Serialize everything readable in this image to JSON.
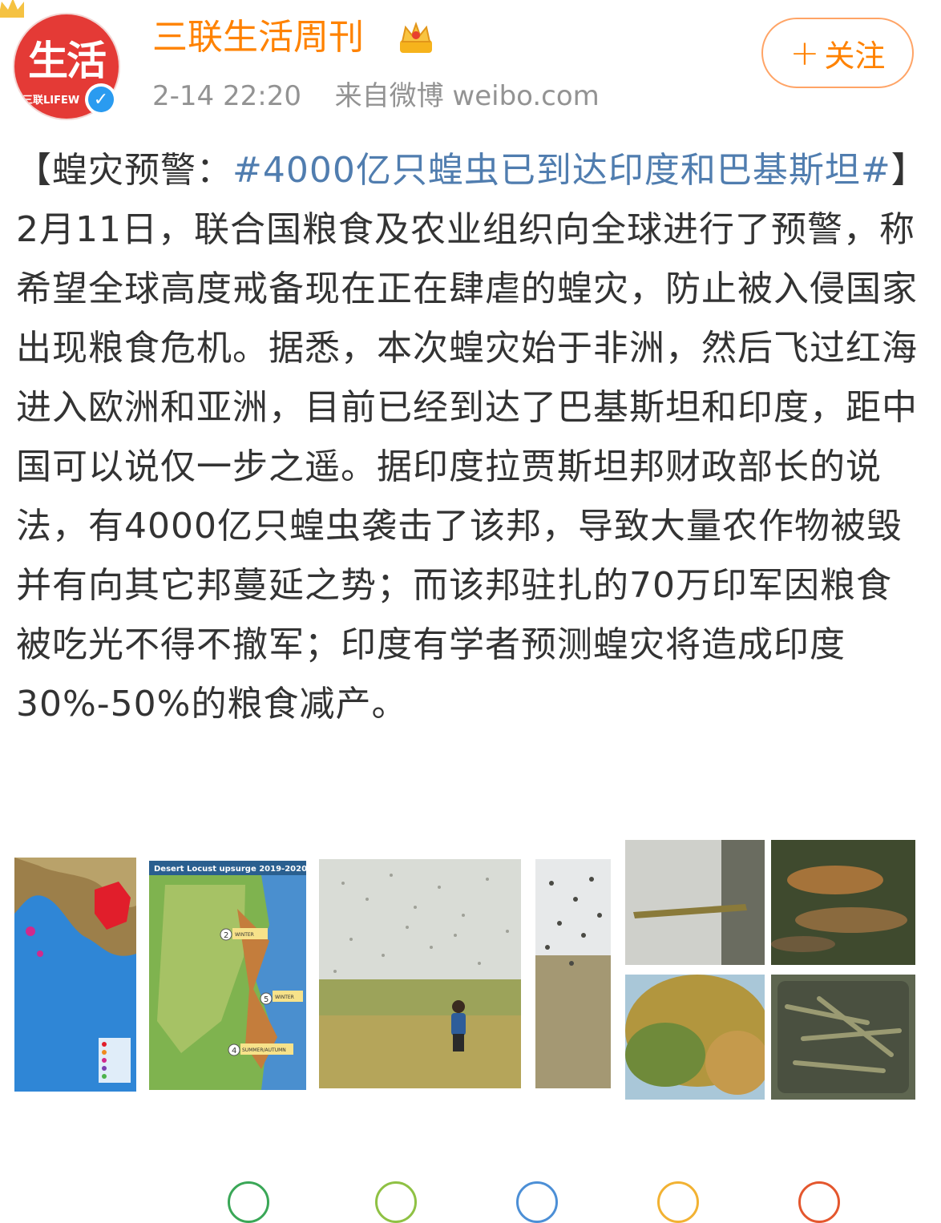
{
  "header": {
    "avatar_text": "生活",
    "avatar_subtext": "三联LIFEW",
    "username": "三联生活周刊",
    "timestamp": "2-14 22:20",
    "source": "来自微博 weibo.com",
    "follow_label": "关注",
    "follow_plus": "+"
  },
  "post": {
    "prefix": "【蝗灾预警：",
    "hashtag": "#4000亿只蝗虫已到达印度和巴基斯坦#",
    "body": "】2月11日，联合国粮食及农业组织向全球进行了预警，称希望全球高度戒备现在正在肆虐的蝗灾，防止被入侵国家出现粮食危机。据悉，本次蝗灾始于非洲，然后飞过红海进入欧洲和亚洲，目前已经到达了巴基斯坦和印度，距中国可以说仅一步之遥。据印度拉贾斯坦邦财政部长的说法，有4000亿只蝗虫袭击了该邦，导致大量农作物被毁并有向其它邦蔓延之势；而该邦驻扎的70万印军因粮食被吃光不得不撤军；印度有学者预测蝗灾将造成印度30%-50%的粮食减产。"
  },
  "images": {
    "map2_title": "Desert Locust upsurge 2019-2020",
    "map2_labels": [
      "2",
      "5",
      "4"
    ],
    "map2_tags": [
      "WINTER",
      "WINTER",
      "SUMMER/AUTUMN"
    ]
  },
  "colors": {
    "username": "#ff8200",
    "hashtag": "#507daf",
    "meta": "#939393",
    "avatar": "#e43a36"
  }
}
